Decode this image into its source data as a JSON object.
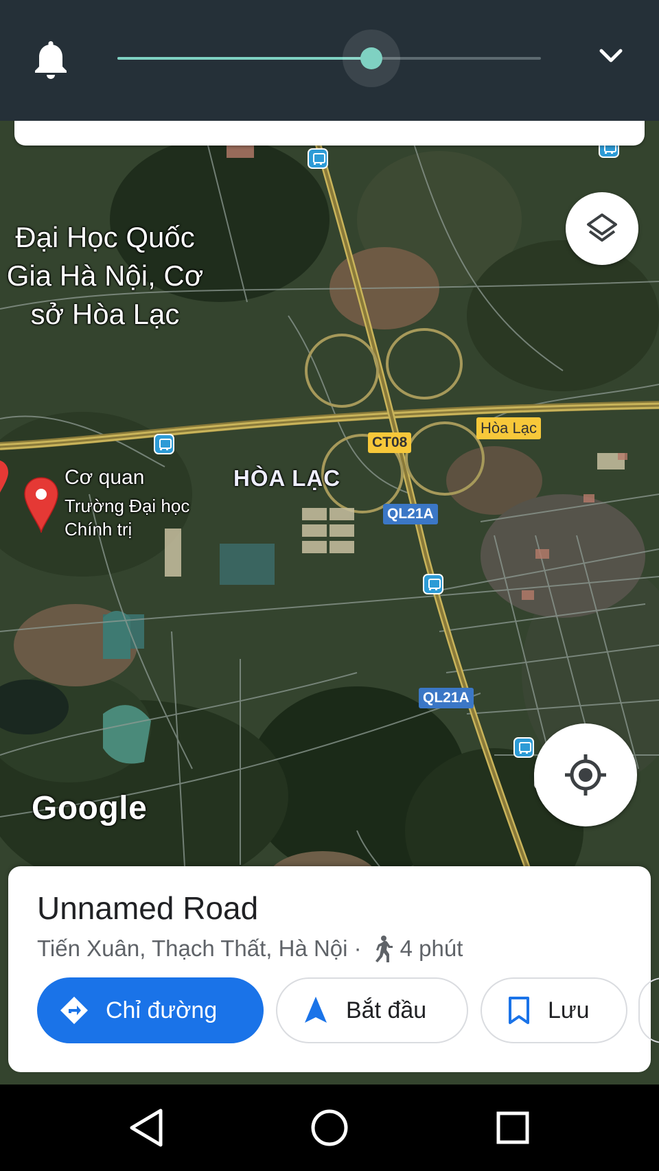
{
  "status": {
    "volume_level": 0.6
  },
  "map": {
    "labels": {
      "university": "Đại Học Quốc Gia Hà Nội, Cơ sở Hòa Lạc",
      "area": "HÒA LẠC",
      "poi_title": "Cơ quan",
      "poi_subtitle": "Trường Đại học Chính trị",
      "place_tag": "Hòa Lạc"
    },
    "road_shields": {
      "ct08": "CT08",
      "ql21a_top": "QL21A",
      "ql21a_bottom": "QL21A"
    },
    "attribution": "Google"
  },
  "sheet": {
    "title": "Unnamed Road",
    "address": "Tiến Xuân, Thạch Thất, Hà Nội ·",
    "walk_time": "4 phút",
    "buttons": {
      "directions": "Chỉ đường",
      "start": "Bắt đầu",
      "save": "Lưu"
    }
  },
  "colors": {
    "accent": "#1a73e8",
    "slider": "#7fd1c2",
    "topbar": "#253038"
  }
}
